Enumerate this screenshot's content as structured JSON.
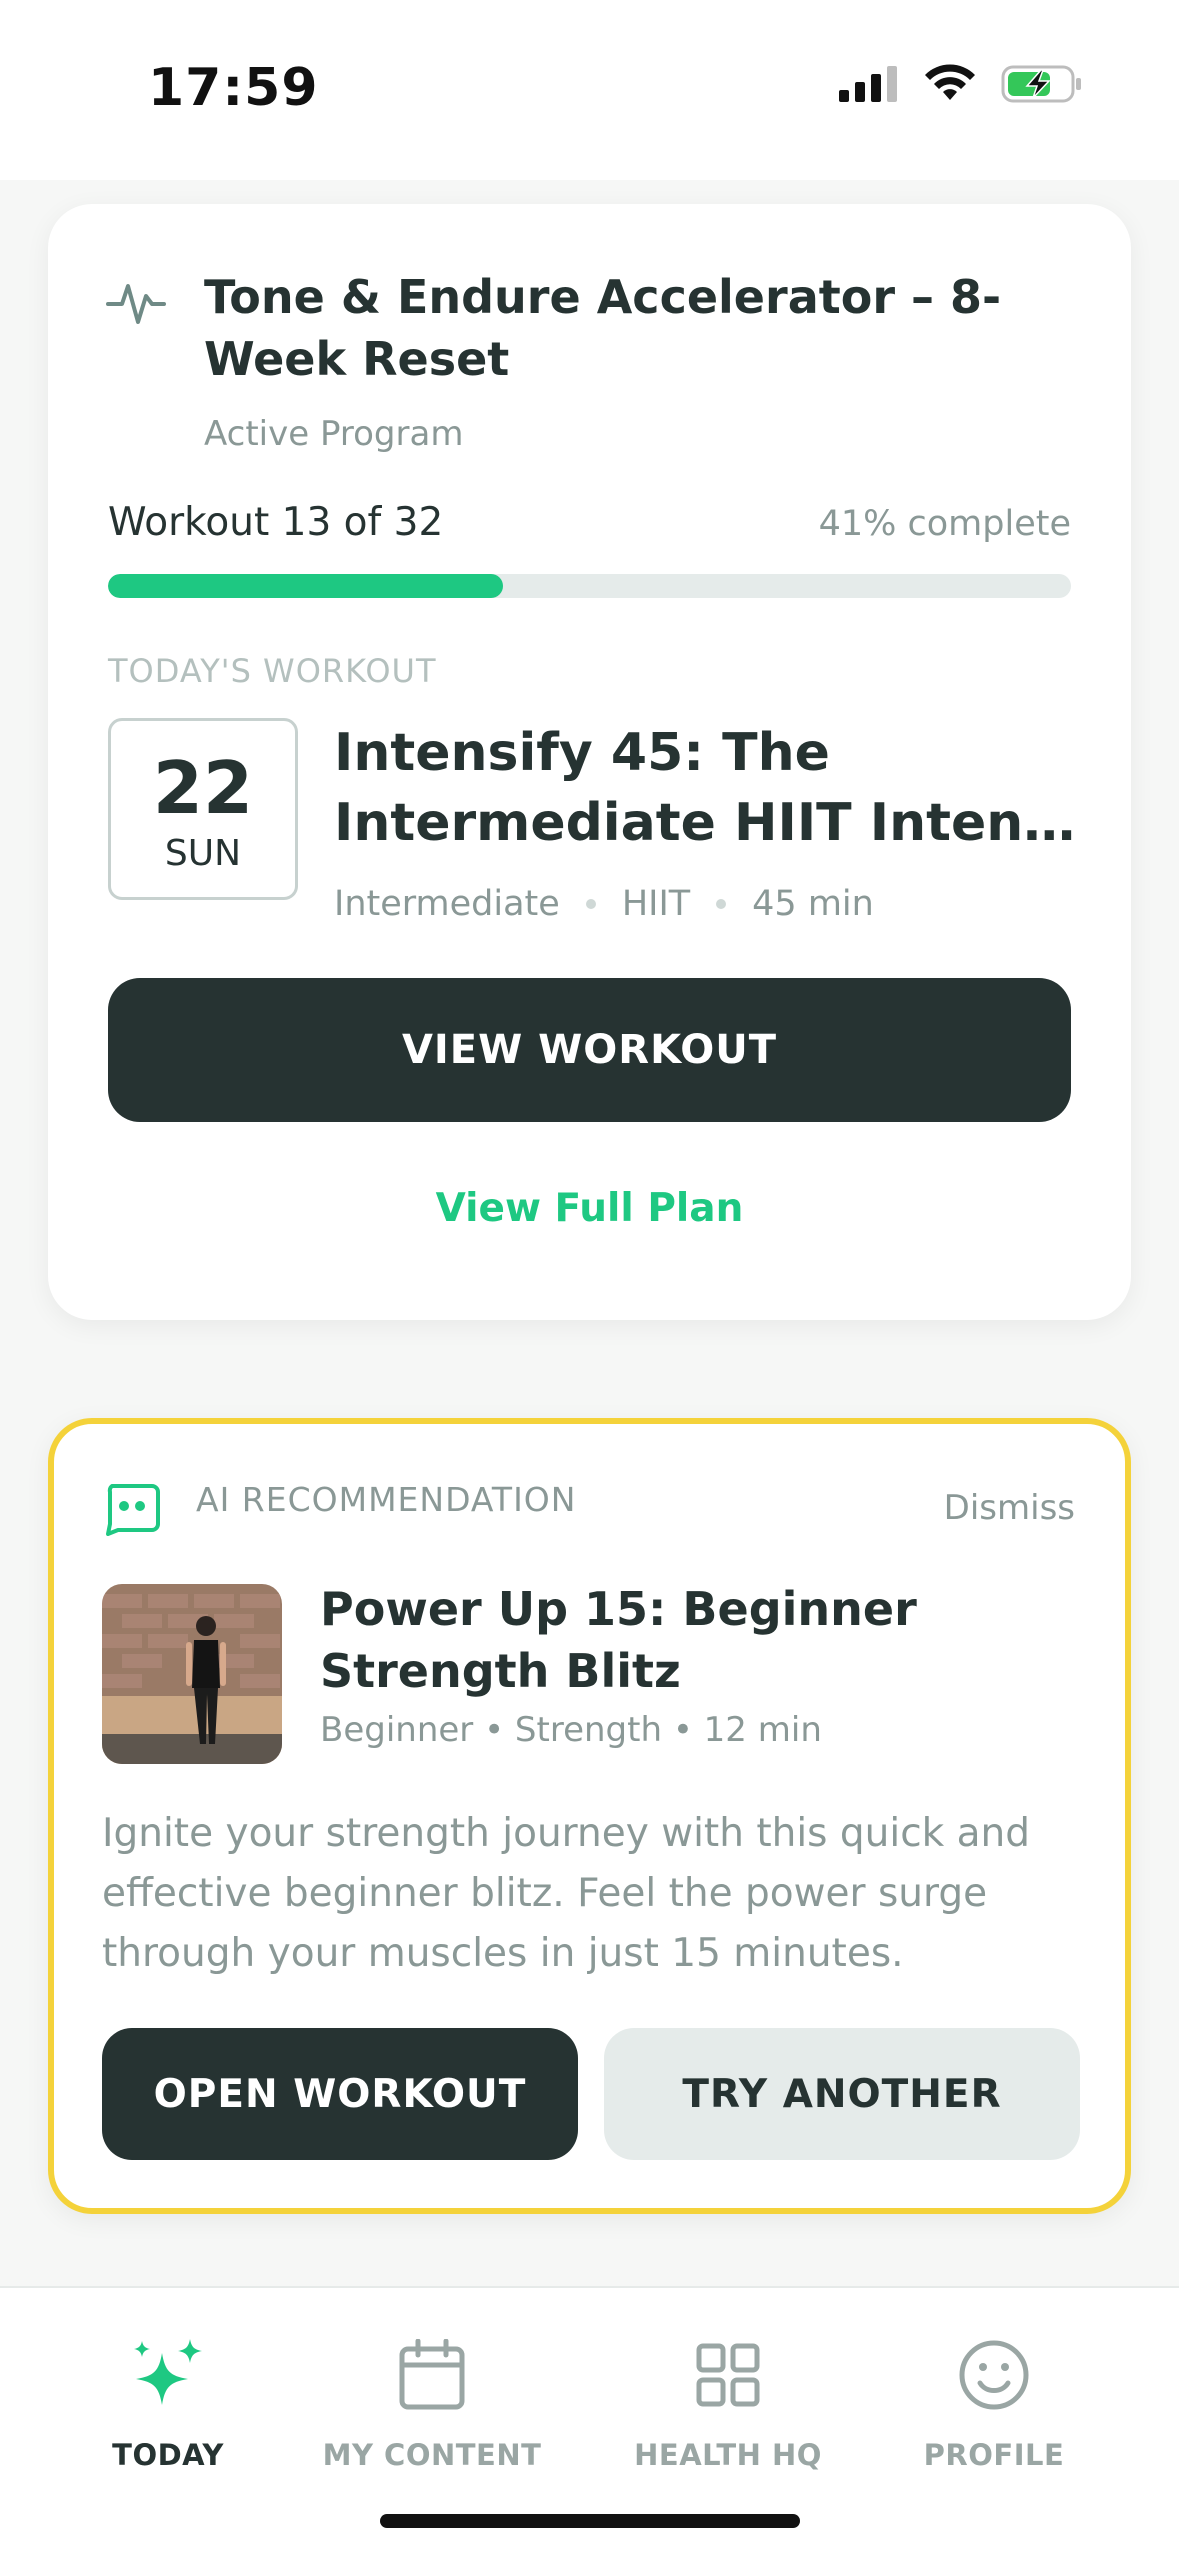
{
  "status_bar": {
    "time": "17:59",
    "icons": [
      "signal-icon",
      "wifi-icon",
      "battery-charging-icon"
    ]
  },
  "program_card": {
    "icon": "activity-pulse-icon",
    "title": "Tone & Endure Accelerator – 8-Week Reset",
    "subtitle": "Active Program",
    "workout_count": "Workout 13 of 32",
    "percent_text": "41% complete",
    "progress_fraction": 0.41,
    "today_label": "TODAY'S WORKOUT",
    "date": {
      "day_number": "22",
      "weekday": "SUN"
    },
    "workout_title_line1": "Intensify 45: The",
    "workout_title_line2": "Intermediate HIIT Intensi...",
    "meta": {
      "level": "Intermediate",
      "type": "HIIT",
      "duration": "45 min"
    },
    "view_workout_label": "VIEW WORKOUT",
    "view_plan_label": "View Full Plan"
  },
  "ai_card": {
    "icon": "robot-face-icon",
    "label": "AI RECOMMENDATION",
    "dismiss_label": "Dismiss",
    "title": "Power Up 15: Beginner Strength Blitz",
    "meta": "Beginner • Strength • 12 min",
    "description": "Ignite your strength journey with this quick and effective beginner blitz. Feel the power surge through your muscles in just 15 minutes.",
    "open_label": "OPEN WORKOUT",
    "try_label": "TRY ANOTHER",
    "border_color": "#f4d23a"
  },
  "tab_bar": {
    "tabs": [
      {
        "label": "TODAY",
        "icon": "sparkles-icon",
        "active": true
      },
      {
        "label": "MY CONTENT",
        "icon": "calendar-icon",
        "active": false
      },
      {
        "label": "HEALTH HQ",
        "icon": "grid-icon",
        "active": false
      },
      {
        "label": "PROFILE",
        "icon": "smiley-icon",
        "active": false
      }
    ]
  },
  "colors": {
    "accent": "#1ec882",
    "dark": "#263332",
    "muted": "#8a9896"
  }
}
